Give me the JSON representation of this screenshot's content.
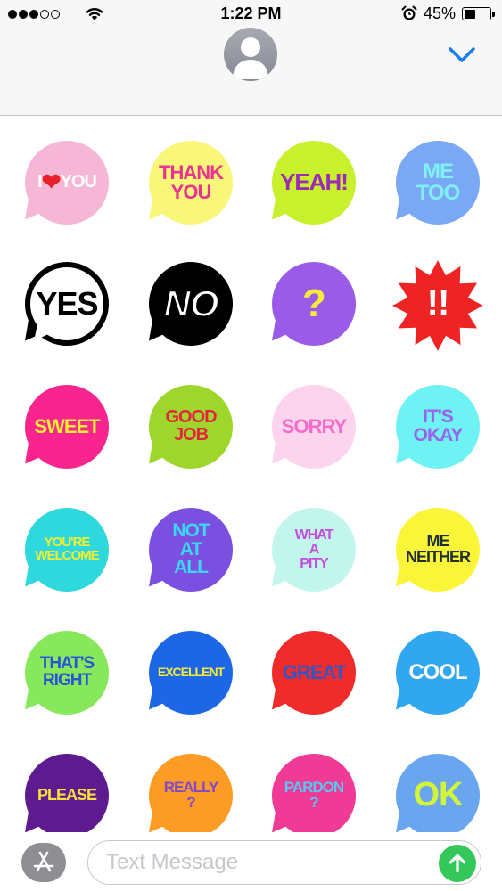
{
  "status_bar": {
    "time": "1:22 PM",
    "battery_percent": "45%",
    "battery_level": 0.45,
    "signal_bars_filled": 3,
    "signal_bars_total": 5
  },
  "header": {
    "avatar_icon": "person-silhouette-icon",
    "expand_icon": "chevron-down-icon",
    "accent_color": "#1a7cf2"
  },
  "stickers": [
    {
      "text": "I ❤ YOU",
      "bg": "#f6b6d5",
      "color": "#ffffff",
      "size": 20
    },
    {
      "text": "THANK\nYOU",
      "bg": "#f9f77a",
      "color": "#e8338f",
      "size": 22
    },
    {
      "text": "YEAH!",
      "bg": "#c9f02d",
      "color": "#9b2bb3",
      "size": 26
    },
    {
      "text": "ME\nTOO",
      "bg": "#7aa8f4",
      "color": "#7ff0f8",
      "size": 24
    },
    {
      "text": "YES",
      "bg": "#ffffff",
      "color": "#000000",
      "size": 36
    },
    {
      "text": "NO",
      "bg": "#000000",
      "color": "#ffffff",
      "size": 42
    },
    {
      "text": "?",
      "bg": "#9a5ce8",
      "color": "#f8ea3a",
      "size": 44
    },
    {
      "text": "!!",
      "bg": "#ee2424",
      "color": "#ffffff",
      "size": 40
    },
    {
      "text": "SWEET",
      "bg": "#f8258e",
      "color": "#f2ee30",
      "size": 22
    },
    {
      "text": "GOOD\nJOB",
      "bg": "#9ed62c",
      "color": "#e4233c",
      "size": 20
    },
    {
      "text": "SORRY",
      "bg": "#fcd4ee",
      "color": "#f36cc8",
      "size": 22
    },
    {
      "text": "IT'S\nOKAY",
      "bg": "#6ff2f4",
      "color": "#9a61ee",
      "size": 21
    },
    {
      "text": "YOU'RE\nWELCOME",
      "bg": "#2ed8dc",
      "color": "#f4ee2c",
      "size": 15
    },
    {
      "text": "NOT\nAT\nALL",
      "bg": "#7b4fe0",
      "color": "#3bd8f6",
      "size": 21
    },
    {
      "text": "WHAT\nA\nPITY",
      "bg": "#c2f6ec",
      "color": "#c44ddf",
      "size": 16
    },
    {
      "text": "ME\nNEITHER",
      "bg": "#fbf53a",
      "color": "#1e2f33",
      "size": 18
    },
    {
      "text": "THAT'S\nRIGHT",
      "bg": "#86e85a",
      "color": "#2a54d8",
      "size": 19
    },
    {
      "text": "EXCELLENT",
      "bg": "#1d67e6",
      "color": "#f8ea3a",
      "size": 14
    },
    {
      "text": "GREAT",
      "bg": "#ef2b2b",
      "color": "#3555c7",
      "size": 22
    },
    {
      "text": "COOL",
      "bg": "#30a7ef",
      "color": "#ffffff",
      "size": 24
    },
    {
      "text": "PLEASE",
      "bg": "#5e1b90",
      "color": "#f6e436",
      "size": 18
    },
    {
      "text": "REALLY\n?",
      "bg": "#fc9c25",
      "color": "#8347cc",
      "size": 17
    },
    {
      "text": "PARDON\n?",
      "bg": "#ef3b95",
      "color": "#58c7f4",
      "size": 17
    },
    {
      "text": "OK",
      "bg": "#6aa6f0",
      "color": "#d2f53a",
      "size": 38
    }
  ],
  "composer": {
    "placeholder": "Text Message",
    "apps_icon": "app-store-icon",
    "send_icon": "arrow-up-icon"
  }
}
